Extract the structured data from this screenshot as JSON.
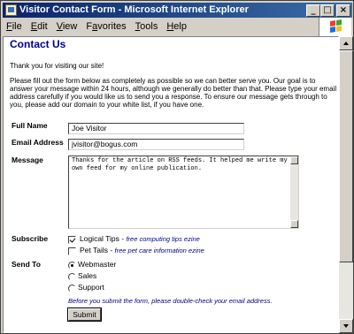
{
  "window": {
    "title": "Visitor Contact Form - Microsoft Internet Explorer",
    "controls": [
      "_",
      "□",
      "×"
    ]
  },
  "menu": {
    "items": [
      {
        "u": "F",
        "rest": "ile"
      },
      {
        "u": "E",
        "rest": "dit"
      },
      {
        "u": "V",
        "rest": "iew"
      },
      {
        "pre": "F",
        "u": "a",
        "rest": "vorites"
      },
      {
        "u": "T",
        "rest": "ools"
      },
      {
        "u": "H",
        "rest": "elp"
      }
    ]
  },
  "page": {
    "heading": "Contact Us",
    "intro": "Thank you for visiting our site!",
    "instructions": "Please fill out the form below as completely as possible so we can better serve you. Our goal is to answer your message within 24 hours, although we generally do better than that. Please type your email address carefully if you would like us to send you a response. To ensure our message gets through to you, please add our domain to your white list, if you have one."
  },
  "form": {
    "full_name_label": "Full Name",
    "full_name_value": "Joe Visitor",
    "email_label": "Email Address",
    "email_value": "jvisitor@bogus.com",
    "message_label": "Message",
    "message_value": "Thanks for the article on RSS feeds. It helped me write my own feed for my online publication.",
    "subscribe_label": "Subscribe",
    "subscribe_options": [
      {
        "name": "Logical Tips",
        "desc": "free computing tips ezine",
        "checked": true
      },
      {
        "name": "Pet Tails",
        "desc": "free pet care information ezine",
        "checked": false
      }
    ],
    "send_to_label": "Send To",
    "send_to_options": [
      {
        "name": "Webmaster",
        "selected": true
      },
      {
        "name": "Sales",
        "selected": false
      },
      {
        "name": "Support",
        "selected": false
      }
    ],
    "note": "Before you submit the form, please double-check your email address.",
    "submit_label": "Submit"
  },
  "colors": {
    "title_gradient_start": "#0a246a",
    "heading": "#00008b",
    "chrome": "#d4d0c8"
  }
}
